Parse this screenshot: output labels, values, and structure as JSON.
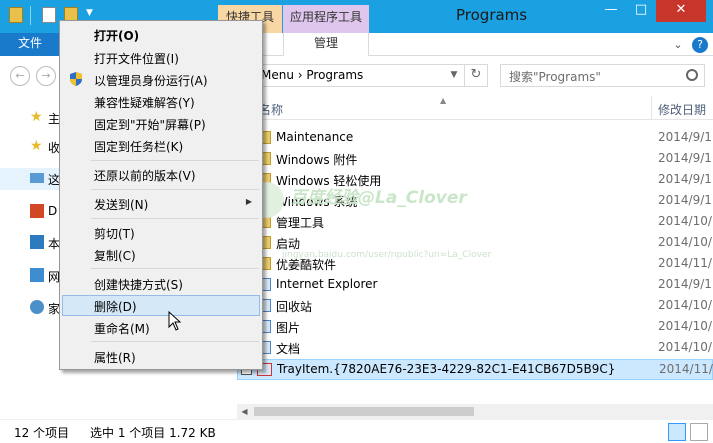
{
  "window": {
    "title": "Programs",
    "ctx_tab_tool": "快捷工具",
    "ctx_tab_app": "应用程序工具",
    "file_tab": "文件",
    "manage_tab": "管理",
    "min": "—",
    "max": "□",
    "close": "✕"
  },
  "address": {
    "path": "Menu  ›  Programs",
    "search_placeholder": "搜索\"Programs\""
  },
  "navpane": {
    "items": [
      {
        "label": "主",
        "icon": "star-icon"
      },
      {
        "label": "收",
        "icon": "star-icon"
      },
      {
        "label": "这",
        "icon": "computer-icon"
      },
      {
        "label": "D",
        "icon": "office-icon"
      },
      {
        "label": "本",
        "icon": "network-icon"
      },
      {
        "label": "网",
        "icon": "network-icon"
      },
      {
        "label": "家",
        "icon": "homegroup-icon"
      }
    ]
  },
  "list": {
    "header_name": "名称",
    "header_date": "修改日期",
    "rows": [
      {
        "name": "Maintenance",
        "date": "2014/9/1",
        "type": "folder"
      },
      {
        "name": "Windows 附件",
        "date": "2014/9/1",
        "type": "folder"
      },
      {
        "name": "Windows 轻松使用",
        "date": "2014/9/1",
        "type": "folder"
      },
      {
        "name": "Windows 系统",
        "date": "2014/9/1",
        "type": "folder"
      },
      {
        "name": "管理工具",
        "date": "2014/10/",
        "type": "folder"
      },
      {
        "name": "启动",
        "date": "2014/10/",
        "type": "folder"
      },
      {
        "name": "优姜酷软件",
        "date": "2014/11/",
        "type": "folder"
      },
      {
        "name": "Internet Explorer",
        "date": "2014/9/1",
        "type": "shortcut"
      },
      {
        "name": "回收站",
        "date": "2014/10/",
        "type": "shortcut"
      },
      {
        "name": "图片",
        "date": "2014/10/",
        "type": "shortcut"
      },
      {
        "name": "文档",
        "date": "2014/10/",
        "type": "shortcut"
      },
      {
        "name": "TrayItem.{7820AE76-23E3-4229-82C1-E41CB67D5B9C}",
        "date": "2014/11/",
        "type": "shortcut"
      }
    ]
  },
  "watermark": {
    "text": "百度经验@La_Clover",
    "url": "jingyan.baidu.com/user/npublic?un=La_Clover"
  },
  "status": {
    "item_count": "12 个项目",
    "selection": "选中 1 个项目  1.72 KB"
  },
  "context_menu": {
    "items": [
      {
        "label": "打开(O)",
        "bold": true
      },
      {
        "label": "打开文件位置(I)"
      },
      {
        "label": "以管理员身份运行(A)",
        "shield": true
      },
      {
        "label": "兼容性疑难解答(Y)"
      },
      {
        "label": "固定到\"开始\"屏幕(P)"
      },
      {
        "label": "固定到任务栏(K)"
      },
      {
        "label": "还原以前的版本(V)"
      },
      {
        "label": "发送到(N)",
        "submenu": true
      },
      {
        "label": "剪切(T)"
      },
      {
        "label": "复制(C)"
      },
      {
        "label": "创建快捷方式(S)"
      },
      {
        "label": "删除(D)",
        "hover": true
      },
      {
        "label": "重命名(M)"
      },
      {
        "label": "属性(R)"
      }
    ]
  },
  "colors": {
    "titlebar": "#1ba0e2",
    "file_tab": "#1979ca",
    "close": "#c7352b",
    "selection": "#cce8ff"
  }
}
